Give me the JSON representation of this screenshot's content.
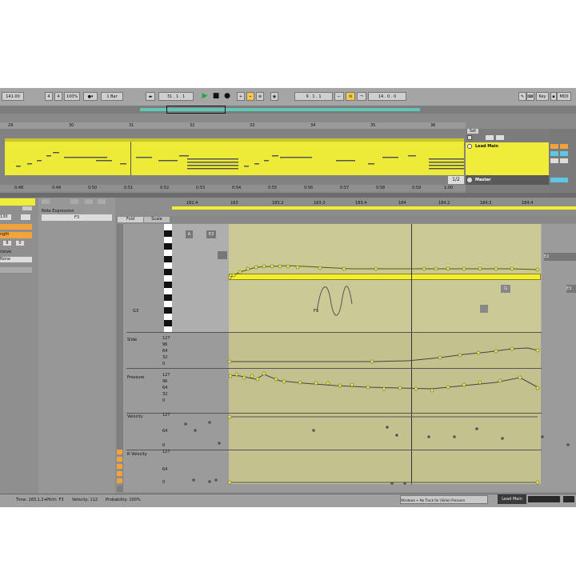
{
  "toolbar": {
    "tempo": "141.00",
    "signature_num": "4",
    "signature_den": "4",
    "zoom": "100%",
    "quantize": "1 Bar",
    "position": "31 . 1 . 1",
    "loop_start": "9 . 1 . 1",
    "loop_length": "14 . 0 . 0",
    "key_label": "Key",
    "midi_label": "MIDI",
    "percent": "2%"
  },
  "arrangement": {
    "bars": [
      "29",
      "30",
      "31",
      "32",
      "33",
      "34",
      "35",
      "36"
    ],
    "times": [
      "0:48",
      "0:49",
      "0:50",
      "0:51",
      "0:52",
      "0:53",
      "0:54",
      "0:55",
      "0:56",
      "0:57",
      "0:58",
      "0:59",
      "1:00"
    ],
    "clip_pager": "1/2",
    "set_label": "Set"
  },
  "tracks": {
    "lead": "Lead Main",
    "master": "Master"
  },
  "left_panel": {
    "v1": "130",
    "v2": "8",
    "v3": "0",
    "label_a": "ngth",
    "label_b": "roove",
    "label_c": "None"
  },
  "note_panel": {
    "title": "Note Expression",
    "pitch": "F3",
    "fold": "Fold",
    "scale": "Scale"
  },
  "editor": {
    "ruler": [
      "182.4",
      "183",
      "183.2",
      "183.3",
      "183.4",
      "184",
      "184.2",
      "184.3",
      "184.4"
    ],
    "note_a": "A",
    "note_e3": "E3",
    "note_e2": "E2",
    "note_g": "G",
    "note_f3": "F3",
    "note_g3": "G3",
    "note_e3b": "E3",
    "lanes": [
      {
        "name": "Slide",
        "ticks": [
          "127",
          "96",
          "64",
          "32",
          "0"
        ]
      },
      {
        "name": "Pressure",
        "ticks": [
          "127",
          "96",
          "64",
          "32",
          "0"
        ]
      },
      {
        "name": "Velocity",
        "ticks": [
          "127",
          "64",
          "0"
        ]
      },
      {
        "name": "R Velocity",
        "ticks": [
          "127",
          "64",
          "0"
        ]
      }
    ]
  },
  "status": {
    "time": "Time: 183.1.2+",
    "pitch": "Pitch: F3",
    "velocity": "Velocity: 112",
    "probability": "Probability: 100%",
    "info": "Windows + No Track for (Slide) Pressure",
    "track": "Lead Main"
  },
  "colors": {
    "clip_yellow": "#eeea38",
    "selection": "#e4e082",
    "accent_orange": "#f2a33a"
  }
}
